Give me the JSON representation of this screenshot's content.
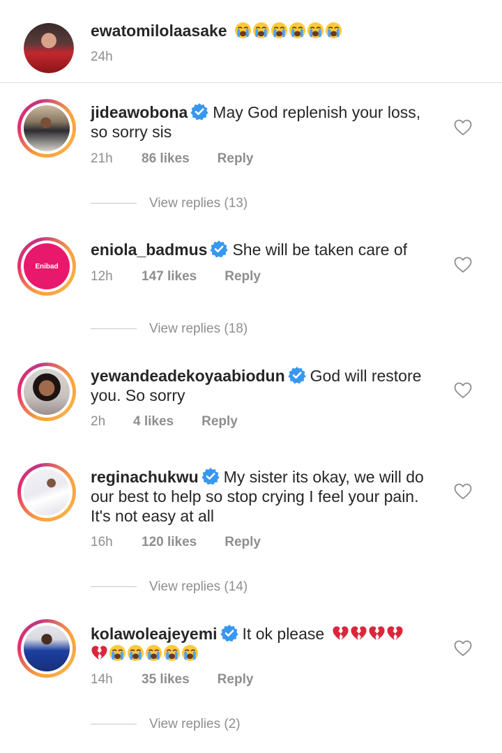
{
  "caption": {
    "username": "ewatomilolaasake",
    "emojis": [
      "crying-face",
      "crying-face",
      "crying-face",
      "crying-face",
      "crying-face",
      "crying-face"
    ],
    "time": "24h"
  },
  "comments": [
    {
      "username": "jideawobona",
      "verified": true,
      "text": "May God replenish your loss, so sorry sis",
      "time": "21h",
      "likes": "86 likes",
      "reply": "Reply",
      "view_replies": "View replies (13)"
    },
    {
      "username": "eniola_badmus",
      "verified": true,
      "text": "She will be taken care of",
      "time": "12h",
      "likes": "147 likes",
      "reply": "Reply",
      "view_replies": "View replies (18)",
      "avatar_logo": "Enibad"
    },
    {
      "username": "yewandeadekoyaabiodun",
      "verified": true,
      "text": "God will restore you. So sorry",
      "time": "2h",
      "likes": "4 likes",
      "reply": "Reply"
    },
    {
      "username": "reginachukwu",
      "verified": true,
      "text": "My sister its okay, we will do our best to help so stop crying I feel your pain. It's not easy at all",
      "time": "16h",
      "likes": "120 likes",
      "reply": "Reply",
      "view_replies": "View replies (14)"
    },
    {
      "username": "kolawoleajeyemi",
      "verified": true,
      "text": "It ok please",
      "emojis": [
        "broken-heart",
        "broken-heart",
        "broken-heart",
        "broken-heart",
        "broken-heart",
        "crying-face",
        "crying-face",
        "crying-face",
        "crying-face",
        "crying-face"
      ],
      "time": "14h",
      "likes": "35 likes",
      "reply": "Reply",
      "view_replies": "View replies (2)"
    }
  ],
  "colors": {
    "text": "#262626",
    "secondary": "#8e8e8e",
    "verified": "#3897f0",
    "divider": "#dbdbdb"
  }
}
